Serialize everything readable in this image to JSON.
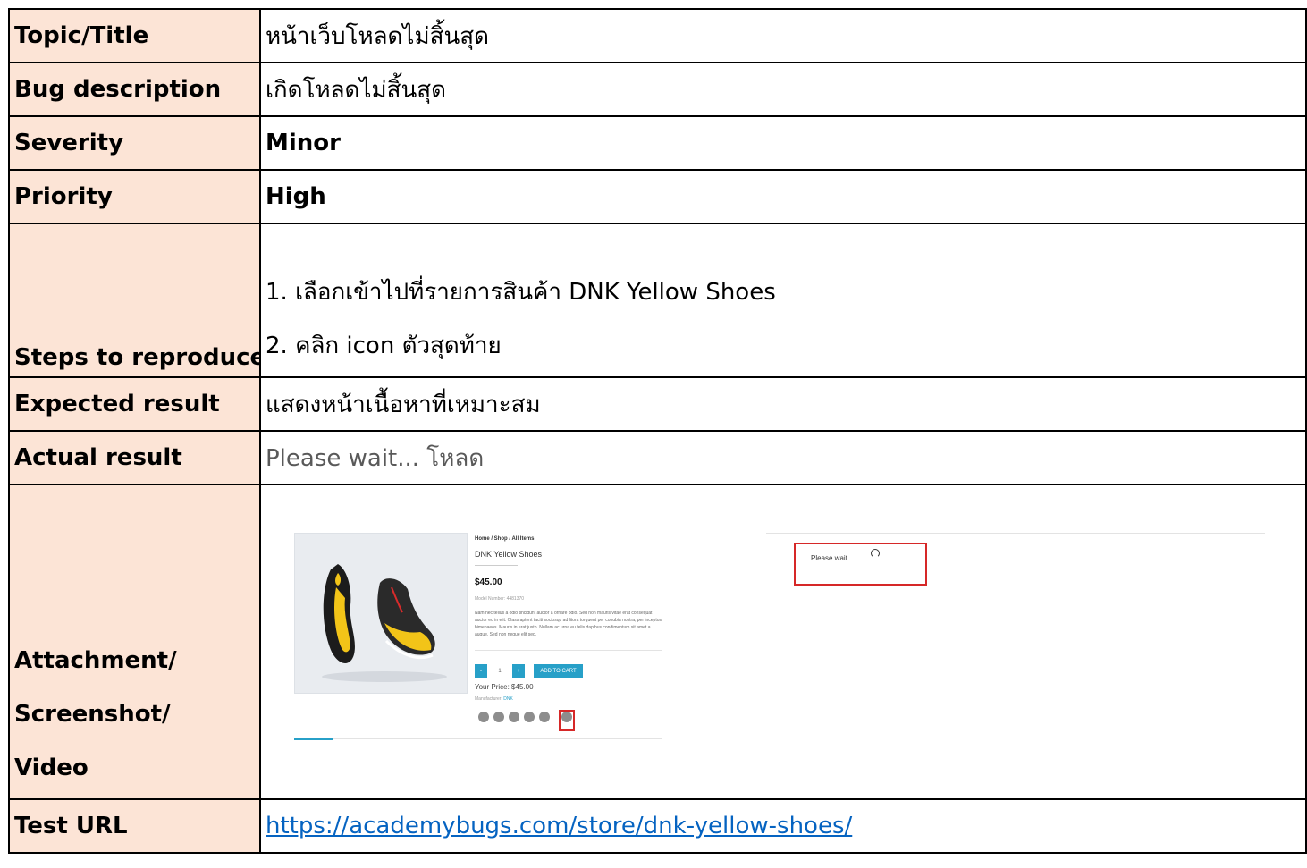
{
  "rows": {
    "topic": {
      "label": "Topic/Title",
      "value": "หน้าเว็บโหลดไม่สิ้นสุด"
    },
    "bug_description": {
      "label": "Bug description",
      "value": "เกิดโหลดไม่สิ้นสุด"
    },
    "severity": {
      "label": "Severity",
      "value": "Minor"
    },
    "priority": {
      "label": "Priority",
      "value": "High"
    },
    "steps": {
      "label": "Steps to reproduce",
      "items": [
        "1. เลือกเข้าไปที่รายการสินค้า DNK Yellow Shoes",
        "2. คลิก icon ตัวสุดท้าย"
      ]
    },
    "expected": {
      "label": "Expected result",
      "value": "แสดงหน้าเนื้อหาที่เหมาะสม"
    },
    "actual": {
      "label": "Actual result",
      "value": "Please wait...  โหลด"
    },
    "attachment": {
      "label_lines": [
        "Attachment/",
        "Screenshot/",
        "Video"
      ]
    },
    "test_url": {
      "label": "Test URL",
      "value": "https://academybugs.com/store/dnk-yellow-shoes/"
    }
  },
  "screenshot": {
    "breadcrumb": "Home / Shop / All Items",
    "product_name": "DNK Yellow Shoes",
    "price": "$45.00",
    "model_number": "Model Number: 4481370",
    "description": "Nam nec tellus a odio tincidunt auctor a ornare odio. Sed non mauris vitae erat consequat auctor eu in elit. Class aptent taciti sociosqu ad litora torquent per conubia nostra, per inceptos himenaeos. Mauris in erat justo. Nullam ac urna eu felis dapibus condimentum sit amet a augue. Sed non neque elit sed.",
    "minus_label": "-",
    "quantity": "1",
    "plus_label": "+",
    "add_to_cart_label": "ADD TO CART",
    "your_price": "Your Price: $45.00",
    "manufacturer_label": "Manufacturer:",
    "manufacturer_value": "DNK",
    "social_icons": [
      "facebook-icon",
      "x-icon",
      "email-icon",
      "pinterest-icon",
      "linkedin-icon",
      "other-share-icon"
    ],
    "loading_text": "Please wait...",
    "accent_color": "#27a0c8",
    "highlight_color": "#d62828"
  }
}
